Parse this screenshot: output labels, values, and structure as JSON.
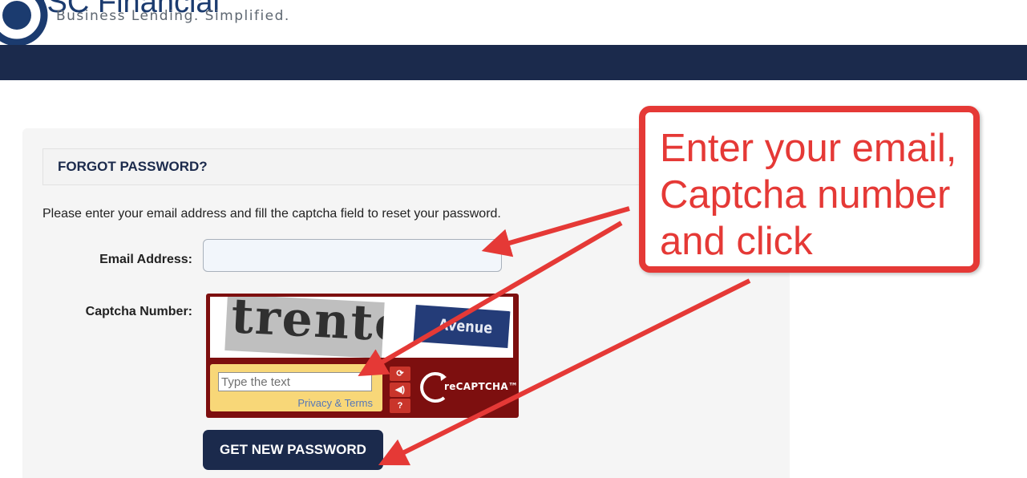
{
  "brand": {
    "name": "ISC Financial",
    "tagline": "Business Lending.  Simplified."
  },
  "panel": {
    "title": "FORGOT PASSWORD?",
    "instructions": "Please enter your email address and fill the captcha field to reset your password."
  },
  "form": {
    "email_label": "Email Address:",
    "email_value": "",
    "captcha_label": "Captcha Number:",
    "submit_label": "GET NEW PASSWORD"
  },
  "recaptcha": {
    "word1": "trento",
    "word2": "Avenue",
    "input_placeholder": "Type the text",
    "privacy_link": "Privacy & Terms",
    "brand": "reCAPTCHA™",
    "buttons": [
      "refresh-icon",
      "audio-icon",
      "help-icon"
    ]
  },
  "annotation": {
    "text": "Enter your email, Captcha number and click",
    "color": "#e53936"
  },
  "colors": {
    "navy": "#1b2a4c",
    "captcha_red": "#7d0f0f",
    "captcha_yellow": "#f8d778"
  }
}
